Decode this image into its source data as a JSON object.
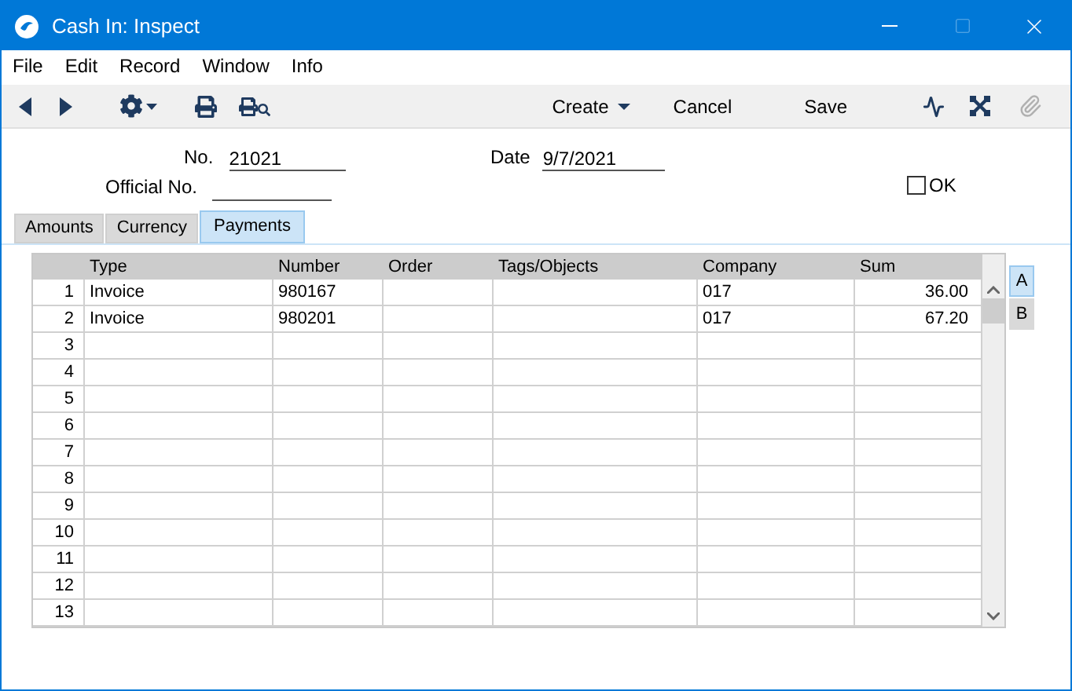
{
  "window": {
    "title": "Cash In: Inspect"
  },
  "menu": [
    "File",
    "Edit",
    "Record",
    "Window",
    "Info"
  ],
  "toolbar": {
    "create": "Create",
    "cancel": "Cancel",
    "save": "Save"
  },
  "fields": {
    "no_label": "No.",
    "no_value": "21021",
    "date_label": "Date",
    "date_value": "9/7/2021",
    "official_label": "Official No.",
    "ok_label": "OK",
    "ok_checked": false
  },
  "tabs": [
    {
      "label": "Amounts",
      "selected": false
    },
    {
      "label": "Currency",
      "selected": false
    },
    {
      "label": "Payments",
      "selected": true
    }
  ],
  "table": {
    "columns": [
      "Type",
      "Number",
      "Order",
      "Tags/Objects",
      "Company",
      "Sum"
    ],
    "rows": [
      {
        "row": "1",
        "type": "Invoice",
        "number": "980167",
        "company": "017",
        "sum": "36.00"
      },
      {
        "row": "2",
        "type": "Invoice",
        "number": "980201",
        "company": "017",
        "sum": "67.20"
      },
      {
        "row": "3"
      },
      {
        "row": "4"
      },
      {
        "row": "5"
      },
      {
        "row": "6"
      },
      {
        "row": "7"
      },
      {
        "row": "8"
      },
      {
        "row": "9"
      },
      {
        "row": "10"
      },
      {
        "row": "11"
      },
      {
        "row": "12"
      },
      {
        "row": "13"
      }
    ]
  },
  "side_tabs": [
    {
      "label": "A",
      "selected": true
    },
    {
      "label": "B",
      "selected": false
    }
  ]
}
